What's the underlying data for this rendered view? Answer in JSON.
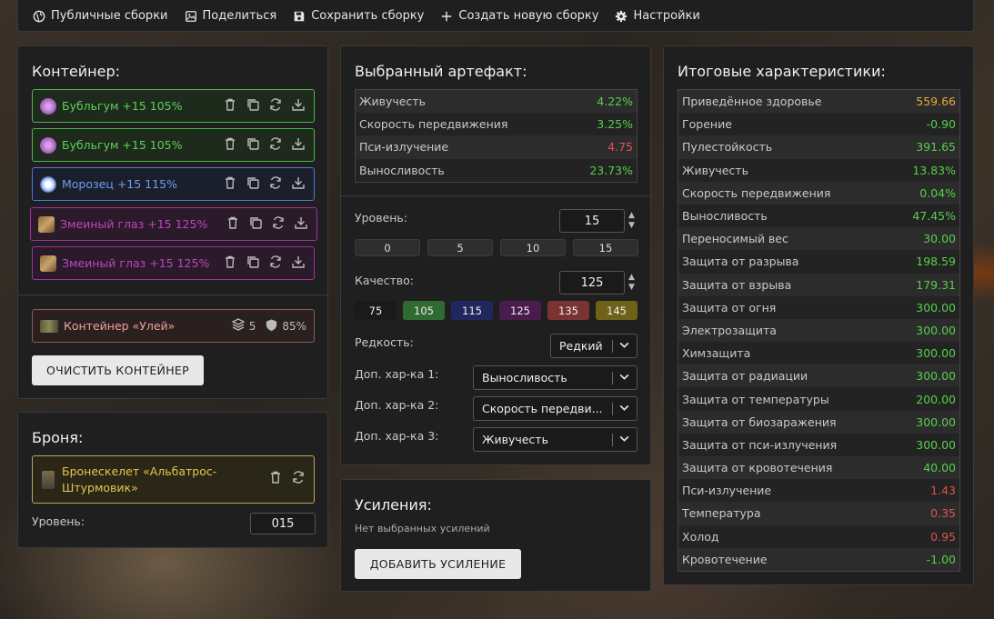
{
  "topbar": {
    "items": [
      {
        "label": "Публичные сборки",
        "icon": "globe-icon"
      },
      {
        "label": "Поделиться",
        "icon": "image-icon"
      },
      {
        "label": "Сохранить сборку",
        "icon": "save-icon"
      },
      {
        "label": "Создать новую сборку",
        "icon": "plus-icon"
      },
      {
        "label": "Настройки",
        "icon": "gear-icon"
      }
    ]
  },
  "container": {
    "title": "Контейнер:",
    "artifacts": [
      {
        "label": "Бубльгум +15 105%",
        "rarity": "green",
        "color": "#5fcf5a"
      },
      {
        "label": "Бубльгум +15 105%",
        "rarity": "green",
        "color": "#5fcf5a"
      },
      {
        "label": "Морозец +15 115%",
        "rarity": "blue",
        "color": "#6d9bf2"
      },
      {
        "label": "Змеиный глаз +15 125%",
        "rarity": "purple",
        "color": "#c244c2"
      },
      {
        "label": "Змеиный глаз +15 125%",
        "rarity": "purple",
        "color": "#c244c2"
      }
    ],
    "box": {
      "label": "Контейнер «Улей»",
      "slots": "5",
      "protection": "85%"
    },
    "clear_label": "ОЧИСТИТЬ КОНТЕЙНЕР"
  },
  "armor": {
    "title": "Броня:",
    "name_line1": "Бронескелет «Альбатрос-",
    "name_line2": "Штурмовик»",
    "level_label": "Уровень:",
    "level_value": "015"
  },
  "artifact": {
    "title": "Выбранный артефакт:",
    "stats": [
      {
        "name": "Живучесть",
        "value": "4.22%",
        "tone": "pos"
      },
      {
        "name": "Скорость передвижения",
        "value": "3.25%",
        "tone": "pos"
      },
      {
        "name": "Пси-излучение",
        "value": "4.75",
        "tone": "neg"
      },
      {
        "name": "Выносливость",
        "value": "23.73%",
        "tone": "pos"
      }
    ],
    "level_label": "Уровень:",
    "level_value": "15",
    "level_presets": [
      "0",
      "5",
      "10",
      "15"
    ],
    "quality_label": "Качество:",
    "quality_value": "125",
    "quality_presets": [
      {
        "label": "75",
        "color": "#1a1a1a"
      },
      {
        "label": "105",
        "color": "#2f6b30"
      },
      {
        "label": "115",
        "color": "#22265e"
      },
      {
        "label": "125",
        "color": "#4a1c4e"
      },
      {
        "label": "135",
        "color": "#7a3333"
      },
      {
        "label": "145",
        "color": "#6e6118"
      }
    ],
    "rarity_label": "Редкость:",
    "rarity_value": "Редкий",
    "extra1_label": "Доп. хар-ка 1:",
    "extra1_value": "Выносливость",
    "extra2_label": "Доп. хар-ка 2:",
    "extra2_value": "Скорость передви...",
    "extra3_label": "Доп. хар-ка 3:",
    "extra3_value": "Живучесть"
  },
  "boosts": {
    "title": "Усиления:",
    "empty_text": "Нет выбранных усилений",
    "add_label": "ДОБАВИТЬ УСИЛЕНИЕ"
  },
  "totals": {
    "title": "Итоговые характеристики:",
    "stats": [
      {
        "name": "Приведённое здоровье",
        "value": "559.66",
        "tone": "gold"
      },
      {
        "name": "Горение",
        "value": "-0.90",
        "tone": "pos"
      },
      {
        "name": "Пулестойкость",
        "value": "391.65",
        "tone": "pos"
      },
      {
        "name": "Живучесть",
        "value": "13.83%",
        "tone": "pos"
      },
      {
        "name": "Скорость передвижения",
        "value": "0.04%",
        "tone": "pos"
      },
      {
        "name": "Выносливость",
        "value": "47.45%",
        "tone": "pos"
      },
      {
        "name": "Переносимый вес",
        "value": "30.00",
        "tone": "pos"
      },
      {
        "name": "Защита от разрыва",
        "value": "198.59",
        "tone": "pos"
      },
      {
        "name": "Защита от взрыва",
        "value": "179.31",
        "tone": "pos"
      },
      {
        "name": "Защита от огня",
        "value": "300.00",
        "tone": "pos"
      },
      {
        "name": "Электрозащита",
        "value": "300.00",
        "tone": "pos"
      },
      {
        "name": "Химзащита",
        "value": "300.00",
        "tone": "pos"
      },
      {
        "name": "Защита от радиации",
        "value": "300.00",
        "tone": "pos"
      },
      {
        "name": "Защита от температуры",
        "value": "200.00",
        "tone": "pos"
      },
      {
        "name": "Защита от биозаражения",
        "value": "300.00",
        "tone": "pos"
      },
      {
        "name": "Защита от пси-излучения",
        "value": "300.00",
        "tone": "pos"
      },
      {
        "name": "Защита от кровотечения",
        "value": "40.00",
        "tone": "pos"
      },
      {
        "name": "Пси-излучение",
        "value": "1.43",
        "tone": "neg"
      },
      {
        "name": "Температура",
        "value": "0.35",
        "tone": "neg"
      },
      {
        "name": "Холод",
        "value": "0.95",
        "tone": "neg"
      },
      {
        "name": "Кровотечение",
        "value": "-1.00",
        "tone": "pos"
      }
    ]
  }
}
